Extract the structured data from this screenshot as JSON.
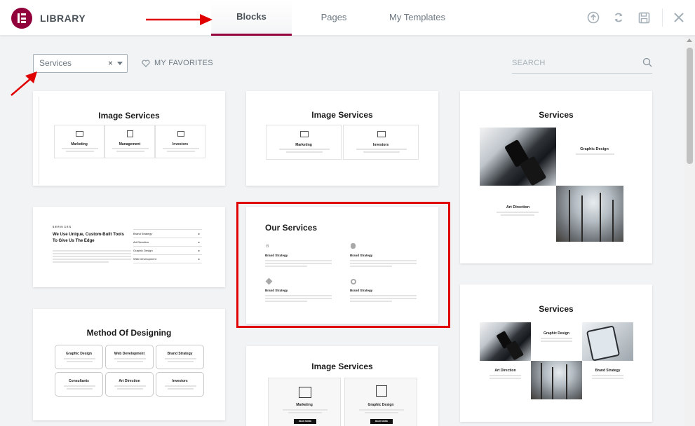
{
  "header": {
    "brand": "LIBRARY",
    "tabs": [
      {
        "label": "Blocks",
        "active": true
      },
      {
        "label": "Pages",
        "active": false
      },
      {
        "label": "My Templates",
        "active": false
      }
    ],
    "icons": [
      "upload-icon",
      "sync-icon",
      "save-icon",
      "close-icon"
    ]
  },
  "toolbar": {
    "filter_value": "Services",
    "filter_clear": "×",
    "favorites_label": "MY FAVORITES",
    "search_placeholder": "SEARCH"
  },
  "cards": {
    "c1": {
      "title": "Image Services",
      "items": [
        "Marketing",
        "Management",
        "Investors"
      ]
    },
    "c2": {
      "title": "Image Services",
      "items": [
        "Marketing",
        "Investors"
      ]
    },
    "c3": {
      "title": "Services",
      "labels": [
        "Graphic Design",
        "Art Direction"
      ]
    },
    "c4": {
      "eyebrow": "SERVICES",
      "heading1": "We Use Unique, Custom-Built Tools",
      "heading2": "To Give Us The Edge",
      "list": [
        "Brand Strategy",
        "Art Direction",
        "Graphic Design",
        "Web Development"
      ]
    },
    "c5": {
      "title": "Our Services",
      "items": [
        "Brand Strategy",
        "Brand Strategy",
        "Brand Strategy",
        "Brand Strategy"
      ]
    },
    "c6": {
      "title": "Services",
      "labels": [
        "Graphic Design",
        "Art Direction",
        "Brand Strategy"
      ]
    },
    "c7": {
      "title": "Method Of Designing",
      "items": [
        "Graphic Design",
        "Web Development",
        "Brand Strategy",
        "Consultants",
        "Art Direction",
        "Investors"
      ]
    },
    "c8": {
      "title": "Image Services",
      "items": [
        "Marketing",
        "Graphic Design"
      ],
      "button": "READ MORE"
    }
  },
  "colors": {
    "brand": "#92003b",
    "active_tab_border": "#93003c",
    "annotation_red": "#e00000"
  }
}
